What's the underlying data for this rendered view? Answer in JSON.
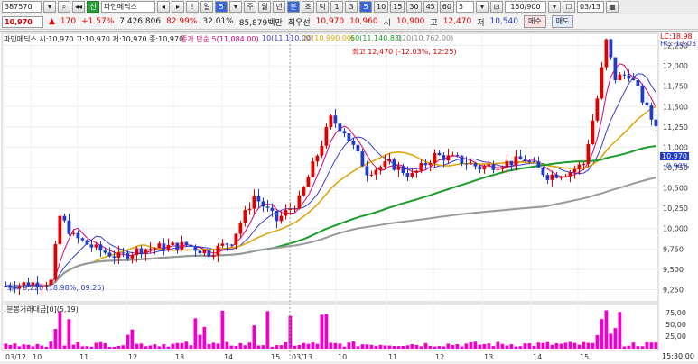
{
  "toolbar": {
    "code": "387570",
    "badge": "신",
    "name": "파인메딕스",
    "flag_btn": "!",
    "period_btn": "일",
    "num_btn": "5",
    "periods": [
      "주",
      "월",
      "년",
      "분",
      "초",
      "틱"
    ],
    "intervals": [
      "1",
      "3",
      "5",
      "10",
      "15",
      "30",
      "45",
      "60"
    ],
    "count_select": "5",
    "range": "150/900",
    "date": "03/13"
  },
  "quote": {
    "price": "10,970",
    "change_arrow": "▲",
    "change": "170",
    "change_pct": "+1.57%",
    "volume": "7,426,806",
    "ratio": "82.99%",
    "turnover_pct": "32.01%",
    "amount": "85,879백만",
    "high_label": "최우선",
    "ask": "10,970",
    "bid": "10,960",
    "open_label": "시",
    "open": "10,900",
    "high_lbl": "고",
    "high": "12,470",
    "low_lbl": "저",
    "low": "10,540",
    "buy": "매수",
    "sell": "매도"
  },
  "legend": {
    "main": "파인메딕스 시:10,970 고:10,970 저:10,970 종:10,970",
    "ma_label": "종가 단순 5(11,084.00)",
    "ma10": "10(11,110.00)",
    "ma20": "20(10,990.00)",
    "ma60": "60(11,140.83)",
    "ma120": "120(10,762.00)",
    "high_note": "최고 12,470 (-12.03%, 12:25)",
    "low_note": "최저 9,220 (18.98%, 09:25)",
    "lc": "LC:18.98",
    "hc": "HC:-12.03",
    "vol_title": "!분봉거래대금[0](5,19)"
  },
  "axis": {
    "prices": [
      "12,250",
      "12,000",
      "11,750",
      "11,500",
      "11,250",
      "11,000",
      "10,750",
      "10,500",
      "10,250",
      "10,000",
      "9,750",
      "9,500",
      "9,250"
    ],
    "current_price": "10,970",
    "current_pct": "-0.90%",
    "vol_ticks": [
      "75,00",
      "50,00",
      "25,00"
    ],
    "time_ticks": [
      "03/12",
      "10",
      "11",
      "12",
      "13",
      "14",
      "15",
      "03/13",
      "10",
      "11",
      "12",
      "13",
      "14",
      "15"
    ],
    "time_right": "15:30:00"
  },
  "colors": {
    "up": "#e00000",
    "down": "#1f3bc8",
    "ma5": "#d8006f",
    "ma10": "#3b3bd0",
    "ma20": "#e0a000",
    "ma60": "#1a9c2a",
    "ma120": "#9a9a9a",
    "vol": "#f000c8"
  }
}
